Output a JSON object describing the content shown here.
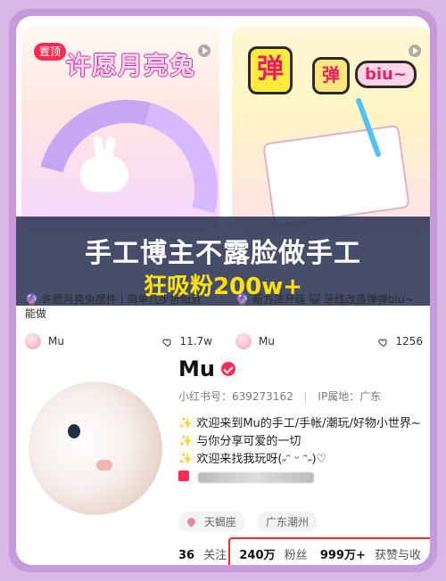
{
  "cards": [
    {
      "badge": "置顶",
      "title": "许愿月亮兔",
      "caption": "🔮 许愿月亮兔摆件 | 简单几步折纸就能做",
      "author": "Mu",
      "likes": "11.7w"
    },
    {
      "title_big1": "弹",
      "title_big2": "弹",
      "title_tag": "biu~",
      "caption": "🔮 新方法升级 🙀 牙线改造弹弹biu~",
      "author": "Mu",
      "likes": "1256"
    }
  ],
  "overlay": {
    "line1": "手工博主不露脸做手工",
    "line2": "狂吸粉200w+"
  },
  "profile": {
    "name": "Mu",
    "id_label": "小红书号：639273162",
    "ip_label": "IP属地：广东",
    "bio": [
      "✨ 欢迎来到Mu的手工/手帐/潮玩/好物小世界~",
      "✨ 与你分享可爱的一切",
      "✨ 欢迎来找我玩呀(˶ᵔ ᵕ ᵔ˶)♡"
    ],
    "tags": [
      "天蝎座",
      "广东潮州"
    ],
    "stats": [
      {
        "num": "36",
        "label": "关注"
      },
      {
        "num": "240万",
        "label": "粉丝"
      },
      {
        "num": "999万+",
        "label": "获赞与收藏"
      }
    ]
  },
  "icons": {
    "verified": "verified-check-icon",
    "heart": "heart-outline-icon",
    "play": "play-icon",
    "location": "location-pin-icon",
    "inbox": "inbox-icon"
  },
  "colors": {
    "accent": "#ff2b55",
    "overlay_text": "#ffffff",
    "overlay_highlight": "#ffe400",
    "frame": "#c79bd9"
  }
}
